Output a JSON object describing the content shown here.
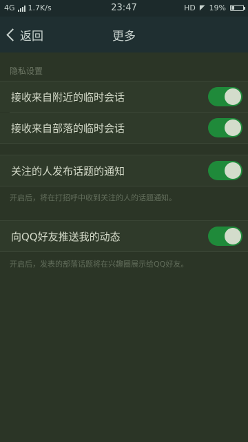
{
  "status_bar": {
    "network": "4G",
    "speed": "1.7K/s",
    "time": "23:47",
    "hd": "HD",
    "battery": "19%",
    "battery_level": 0.19
  },
  "nav": {
    "back_label": "返回",
    "title": "更多"
  },
  "section": {
    "header": "隐私设置"
  },
  "settings": [
    {
      "label": "接收来自附近的临时会话",
      "enabled": true
    },
    {
      "label": "接收来自部落的临时会话",
      "enabled": true
    },
    {
      "label": "关注的人发布话题的通知",
      "enabled": true
    },
    {
      "label": "向QQ好友推送我的动态",
      "enabled": true
    }
  ],
  "notes": {
    "topic_notice": "开启后，将在打招呼中收到关注的人的话题通知。",
    "push_notice": "开启后，发表的部落话题将在兴趣圈展示给QQ好友。"
  },
  "colors": {
    "toggle_on": "#1f8a3a",
    "background": "#2b3526",
    "navbar": "#1f2f31"
  }
}
